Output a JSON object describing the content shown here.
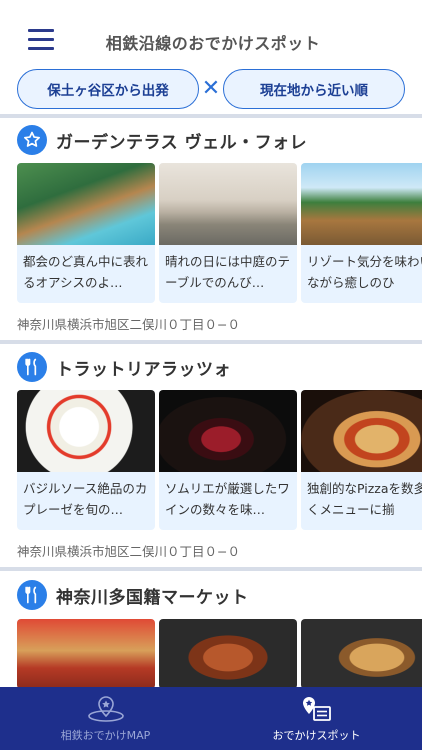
{
  "header": {
    "title": "相鉄沿線のおでかけスポット",
    "menu_icon": "hamburger-menu-icon"
  },
  "filters": {
    "area": "保土ヶ谷区から出発",
    "separator": "✕",
    "sort": "現在地から近い順"
  },
  "sections": [
    {
      "icon": "star-icon",
      "title": "ガーデンテラス ヴェル・フォレ",
      "address": "神奈川県横浜市旭区二俣川０丁目０−０",
      "cards": [
        {
          "text": "都会のど真ん中に表れるオアシスのよ…"
        },
        {
          "text": "晴れの日には中庭のテーブルでのんび…"
        },
        {
          "text": "リゾート気分を味わいながら癒しのひ"
        }
      ]
    },
    {
      "icon": "fork-knife-icon",
      "title": "トラットリアラッツォ",
      "address": "神奈川県横浜市旭区二俣川０丁目０−０",
      "cards": [
        {
          "text": "バジルソース絶品のカプレーゼを旬の…"
        },
        {
          "text": "ソムリエが厳選したワインの数々を味…"
        },
        {
          "text": "独創的なPizzaを数多くメニューに揃"
        }
      ]
    },
    {
      "icon": "fork-knife-icon",
      "title": "神奈川多国籍マーケット"
    }
  ],
  "bottom_nav": [
    {
      "label": "相鉄おでかけMAP",
      "icon": "map-pin-icon",
      "active": false
    },
    {
      "label": "おでかけスポット",
      "icon": "spot-list-icon",
      "active": true
    }
  ],
  "colors": {
    "accent": "#2b7fe8",
    "nav_bg": "#1e2f8c",
    "pill_bg": "#eaf3ff",
    "card_bg": "#e8f3ff"
  }
}
